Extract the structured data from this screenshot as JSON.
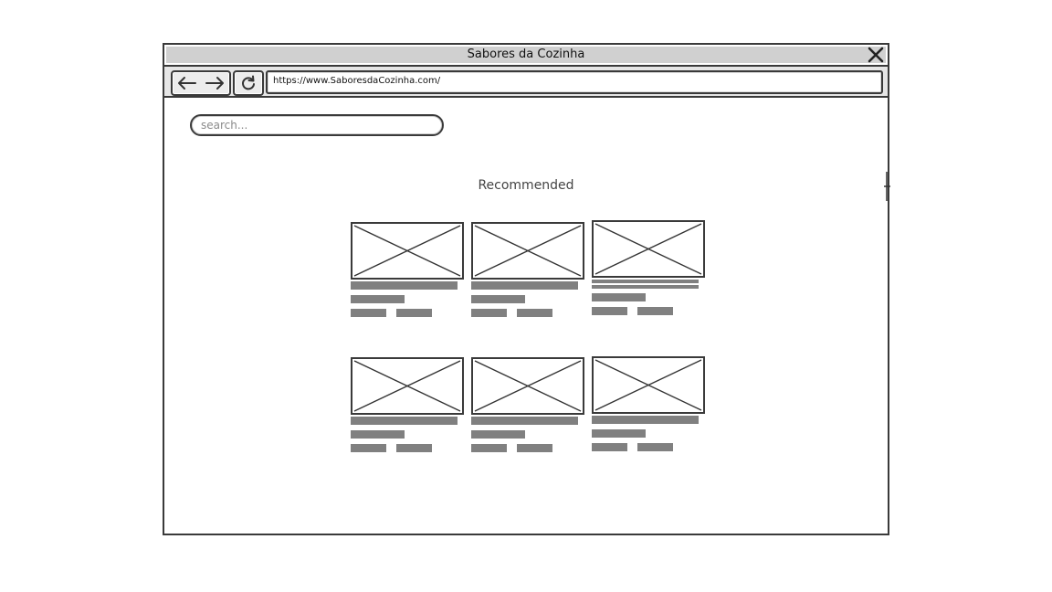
{
  "window": {
    "title": "Sabores da Cozinha",
    "url": "https://www.SaboresdaCozinha.com/"
  },
  "toolbar": {
    "back_icon": "arrow-left-icon",
    "forward_icon": "arrow-right-icon",
    "reload_icon": "reload-icon",
    "close_icon": "close-icon"
  },
  "search": {
    "placeholder": "search..."
  },
  "main": {
    "heading": "Recommended",
    "cards": [
      {
        "image": "image-placeholder"
      },
      {
        "image": "image-placeholder"
      },
      {
        "image": "image-placeholder"
      },
      {
        "image": "image-placeholder"
      },
      {
        "image": "image-placeholder"
      },
      {
        "image": "image-placeholder"
      }
    ]
  },
  "colors": {
    "frame": "#3a3a3a",
    "titlebar": "#d0d0d0",
    "placeholder_bar": "#808080"
  }
}
